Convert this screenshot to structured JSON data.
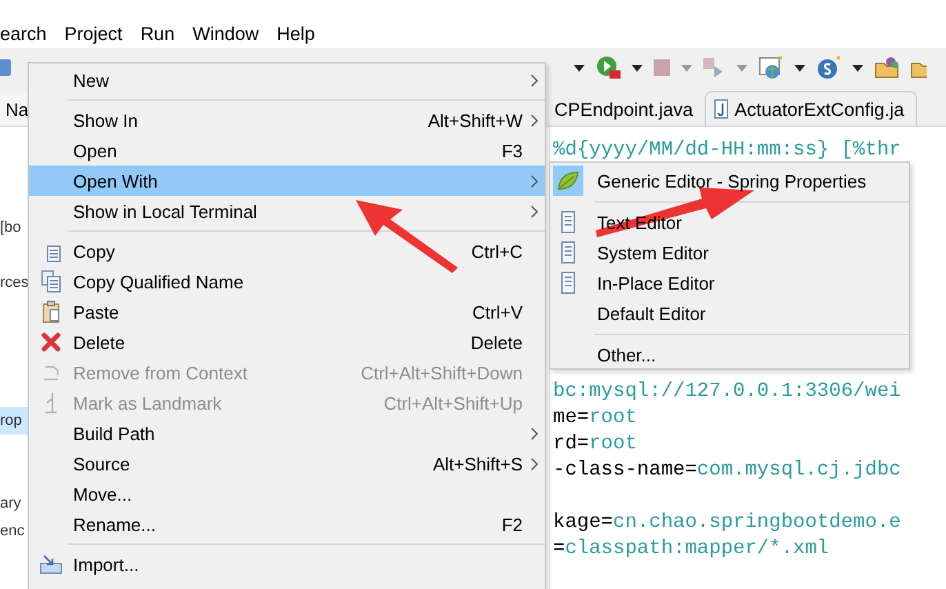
{
  "menu_bar": [
    "earch",
    "Project",
    "Run",
    "Window",
    "Help"
  ],
  "side_tab": {
    "label": "Na"
  },
  "editor_tabs": [
    {
      "label": "CPEndpoint.java",
      "selected": false
    },
    {
      "label": "ActuatorExtConfig.ja",
      "selected": false
    }
  ],
  "explorer": {
    "groups": [
      [
        {
          "label": "[bo",
          "selected": false
        }
      ],
      [
        {
          "label": "rces",
          "selected": false
        }
      ],
      [
        {
          "label": "rop",
          "selected": true
        }
      ],
      [
        {
          "label": "ary",
          "selected": false
        },
        {
          "label": "enc",
          "selected": false
        }
      ]
    ]
  },
  "editor": {
    "blocks": [
      [
        [
          {
            "text": "%d{yyyy/MM/dd-HH:mm:ss} [%thr",
            "kind": "value"
          }
        ]
      ],
      [
        [
          {
            "text": "bc:mysql://127.0.0.1:3306/wei",
            "kind": "value"
          }
        ],
        [
          {
            "text": "me=",
            "kind": "key"
          },
          {
            "text": "root",
            "kind": "value"
          }
        ],
        [
          {
            "text": "rd=",
            "kind": "key"
          },
          {
            "text": "root",
            "kind": "value"
          }
        ],
        [
          {
            "text": "-class-name=",
            "kind": "key"
          },
          {
            "text": "com.mysql.cj.jdbc",
            "kind": "value"
          }
        ]
      ],
      [
        [
          {
            "text": "kage=",
            "kind": "key"
          },
          {
            "text": "cn.chao.springbootdemo.e",
            "kind": "value"
          }
        ],
        [
          {
            "text": "=",
            "kind": "key"
          },
          {
            "text": "classpath:mapper/*.xml",
            "kind": "value"
          }
        ]
      ]
    ]
  },
  "context_menu": {
    "items": [
      {
        "kind": "plain",
        "label": "New",
        "submenu": true,
        "disabled": false,
        "selected": false
      },
      {
        "kind": "separator"
      },
      {
        "kind": "plain",
        "label": "Show In",
        "shortcut": "Alt+Shift+W",
        "submenu": true,
        "disabled": false,
        "selected": false
      },
      {
        "kind": "plain",
        "label": "Open",
        "shortcut": "F3",
        "submenu": false,
        "disabled": false,
        "selected": false
      },
      {
        "kind": "plain",
        "label": "Open With",
        "submenu": true,
        "disabled": false,
        "selected": true
      },
      {
        "kind": "plain",
        "label": "Show in Local Terminal",
        "submenu": true,
        "disabled": false,
        "selected": false
      },
      {
        "kind": "separator"
      },
      {
        "kind": "copy",
        "label": "Copy",
        "shortcut": "Ctrl+C",
        "submenu": false,
        "disabled": false,
        "selected": false
      },
      {
        "kind": "duplicate",
        "label": "Copy Qualified Name",
        "submenu": false,
        "disabled": false,
        "selected": false
      },
      {
        "kind": "paste",
        "label": "Paste",
        "shortcut": "Ctrl+V",
        "submenu": false,
        "disabled": false,
        "selected": false
      },
      {
        "kind": "delete",
        "label": "Delete",
        "shortcut": "Delete",
        "submenu": false,
        "disabled": false,
        "selected": false
      },
      {
        "kind": "remove",
        "label": "Remove from Context",
        "shortcut": "Ctrl+Alt+Shift+Down",
        "submenu": false,
        "disabled": true,
        "selected": false
      },
      {
        "kind": "landmark",
        "label": "Mark as Landmark",
        "shortcut": "Ctrl+Alt+Shift+Up",
        "submenu": false,
        "disabled": true,
        "selected": false
      },
      {
        "kind": "plain",
        "label": "Build Path",
        "submenu": true,
        "disabled": false,
        "selected": false
      },
      {
        "kind": "plain",
        "label": "Source",
        "shortcut": "Alt+Shift+S",
        "submenu": true,
        "disabled": false,
        "selected": false
      },
      {
        "kind": "plain",
        "label": "Move...",
        "submenu": false,
        "disabled": false,
        "selected": false
      },
      {
        "kind": "plain",
        "label": "Rename...",
        "shortcut": "F2",
        "submenu": false,
        "disabled": false,
        "selected": false
      },
      {
        "kind": "separator"
      },
      {
        "kind": "import",
        "label": "Import...",
        "submenu": false,
        "disabled": false,
        "selected": false
      }
    ]
  },
  "open_with_menu": {
    "items": [
      {
        "kind": "spring",
        "label": "Generic Editor - Spring Properties",
        "current": true
      },
      {
        "kind": "separator"
      },
      {
        "kind": "document",
        "label": "Text Editor",
        "current": false
      },
      {
        "kind": "document",
        "label": "System Editor",
        "current": false
      },
      {
        "kind": "document",
        "label": "In-Place Editor",
        "current": false
      },
      {
        "kind": "plain",
        "label": "Default Editor",
        "current": false
      },
      {
        "kind": "separator"
      },
      {
        "kind": "plain",
        "label": "Other...",
        "current": false
      }
    ]
  }
}
